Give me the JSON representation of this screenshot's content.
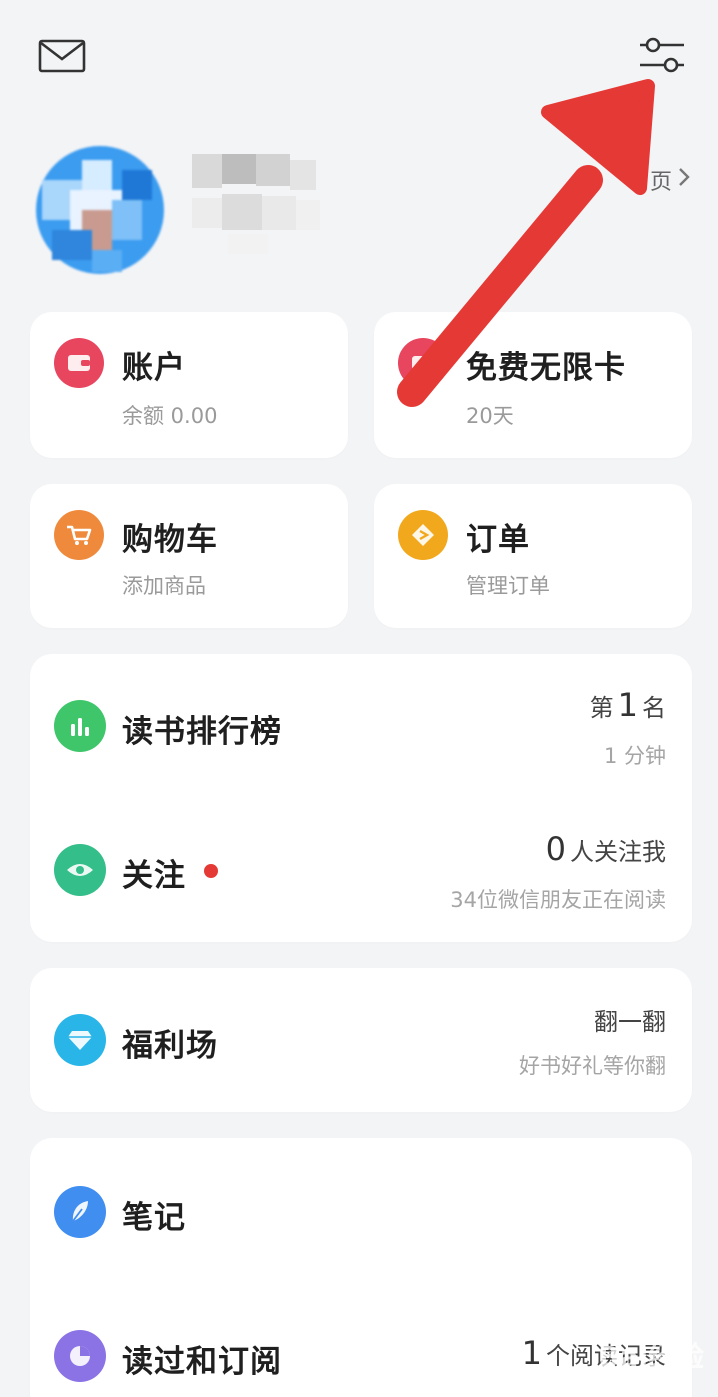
{
  "profile": {
    "homepage_link": "页"
  },
  "tiles": {
    "account": {
      "title": "账户",
      "subtitle": "余额 0.00"
    },
    "free_card": {
      "title": "免费无限卡",
      "subtitle": "20天"
    },
    "cart": {
      "title": "购物车",
      "subtitle": "添加商品"
    },
    "orders": {
      "title": "订单",
      "subtitle": "管理订单"
    }
  },
  "rank_section": {
    "ranking": {
      "title": "读书排行榜",
      "rank_prefix": "第",
      "rank_value": "1",
      "rank_suffix": "名",
      "time": "1 分钟"
    },
    "follow": {
      "title": "关注",
      "count": "0",
      "count_suffix": "人关注我",
      "friends_reading": "34位微信朋友正在阅读"
    }
  },
  "welfare": {
    "title": "福利场",
    "action": "翻一翻",
    "subtitle": "好书好礼等你翻"
  },
  "bottom_section": {
    "notes": {
      "title": "笔记"
    },
    "history": {
      "title": "读过和订阅",
      "count": "1",
      "count_suffix": "个阅读记录"
    }
  },
  "watermark": "Bai经验",
  "colors": {
    "account_icon": "#e8455f",
    "free_card_icon": "#e8455f",
    "cart_icon": "#ef8a3c",
    "orders_icon": "#f2a81c",
    "ranking_icon": "#3fc66a",
    "follow_icon": "#34be8a",
    "welfare_icon": "#29b5e8",
    "notes_icon": "#3f8ef0",
    "history_icon": "#8b73e6",
    "arrow": "#e53935"
  }
}
